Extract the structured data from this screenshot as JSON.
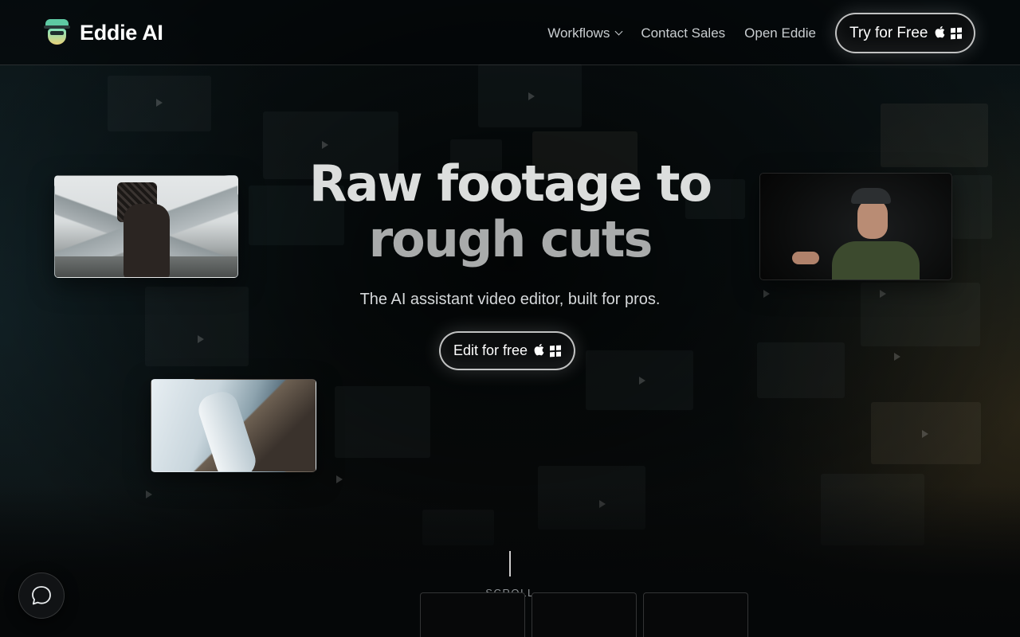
{
  "brand": {
    "name": "Eddie AI",
    "logo_icon": "eddie-face-logo"
  },
  "nav": {
    "workflows": "Workflows",
    "contact_sales": "Contact Sales",
    "open_eddie": "Open Eddie",
    "try_free": "Try for Free",
    "os_icons": [
      "apple-icon",
      "windows-icon"
    ]
  },
  "hero": {
    "title_line1": "Raw footage to",
    "title_line2": "rough cuts",
    "subtitle": "The AI assistant video editor, built for pros.",
    "cta_label": "Edit for free"
  },
  "scroll": {
    "label": "SCROLL"
  },
  "chat": {
    "icon": "chat-bubble-icon"
  },
  "colors": {
    "background": "#050708",
    "text": "#e6e8ea",
    "accent_logo": "#5ec9a3"
  }
}
